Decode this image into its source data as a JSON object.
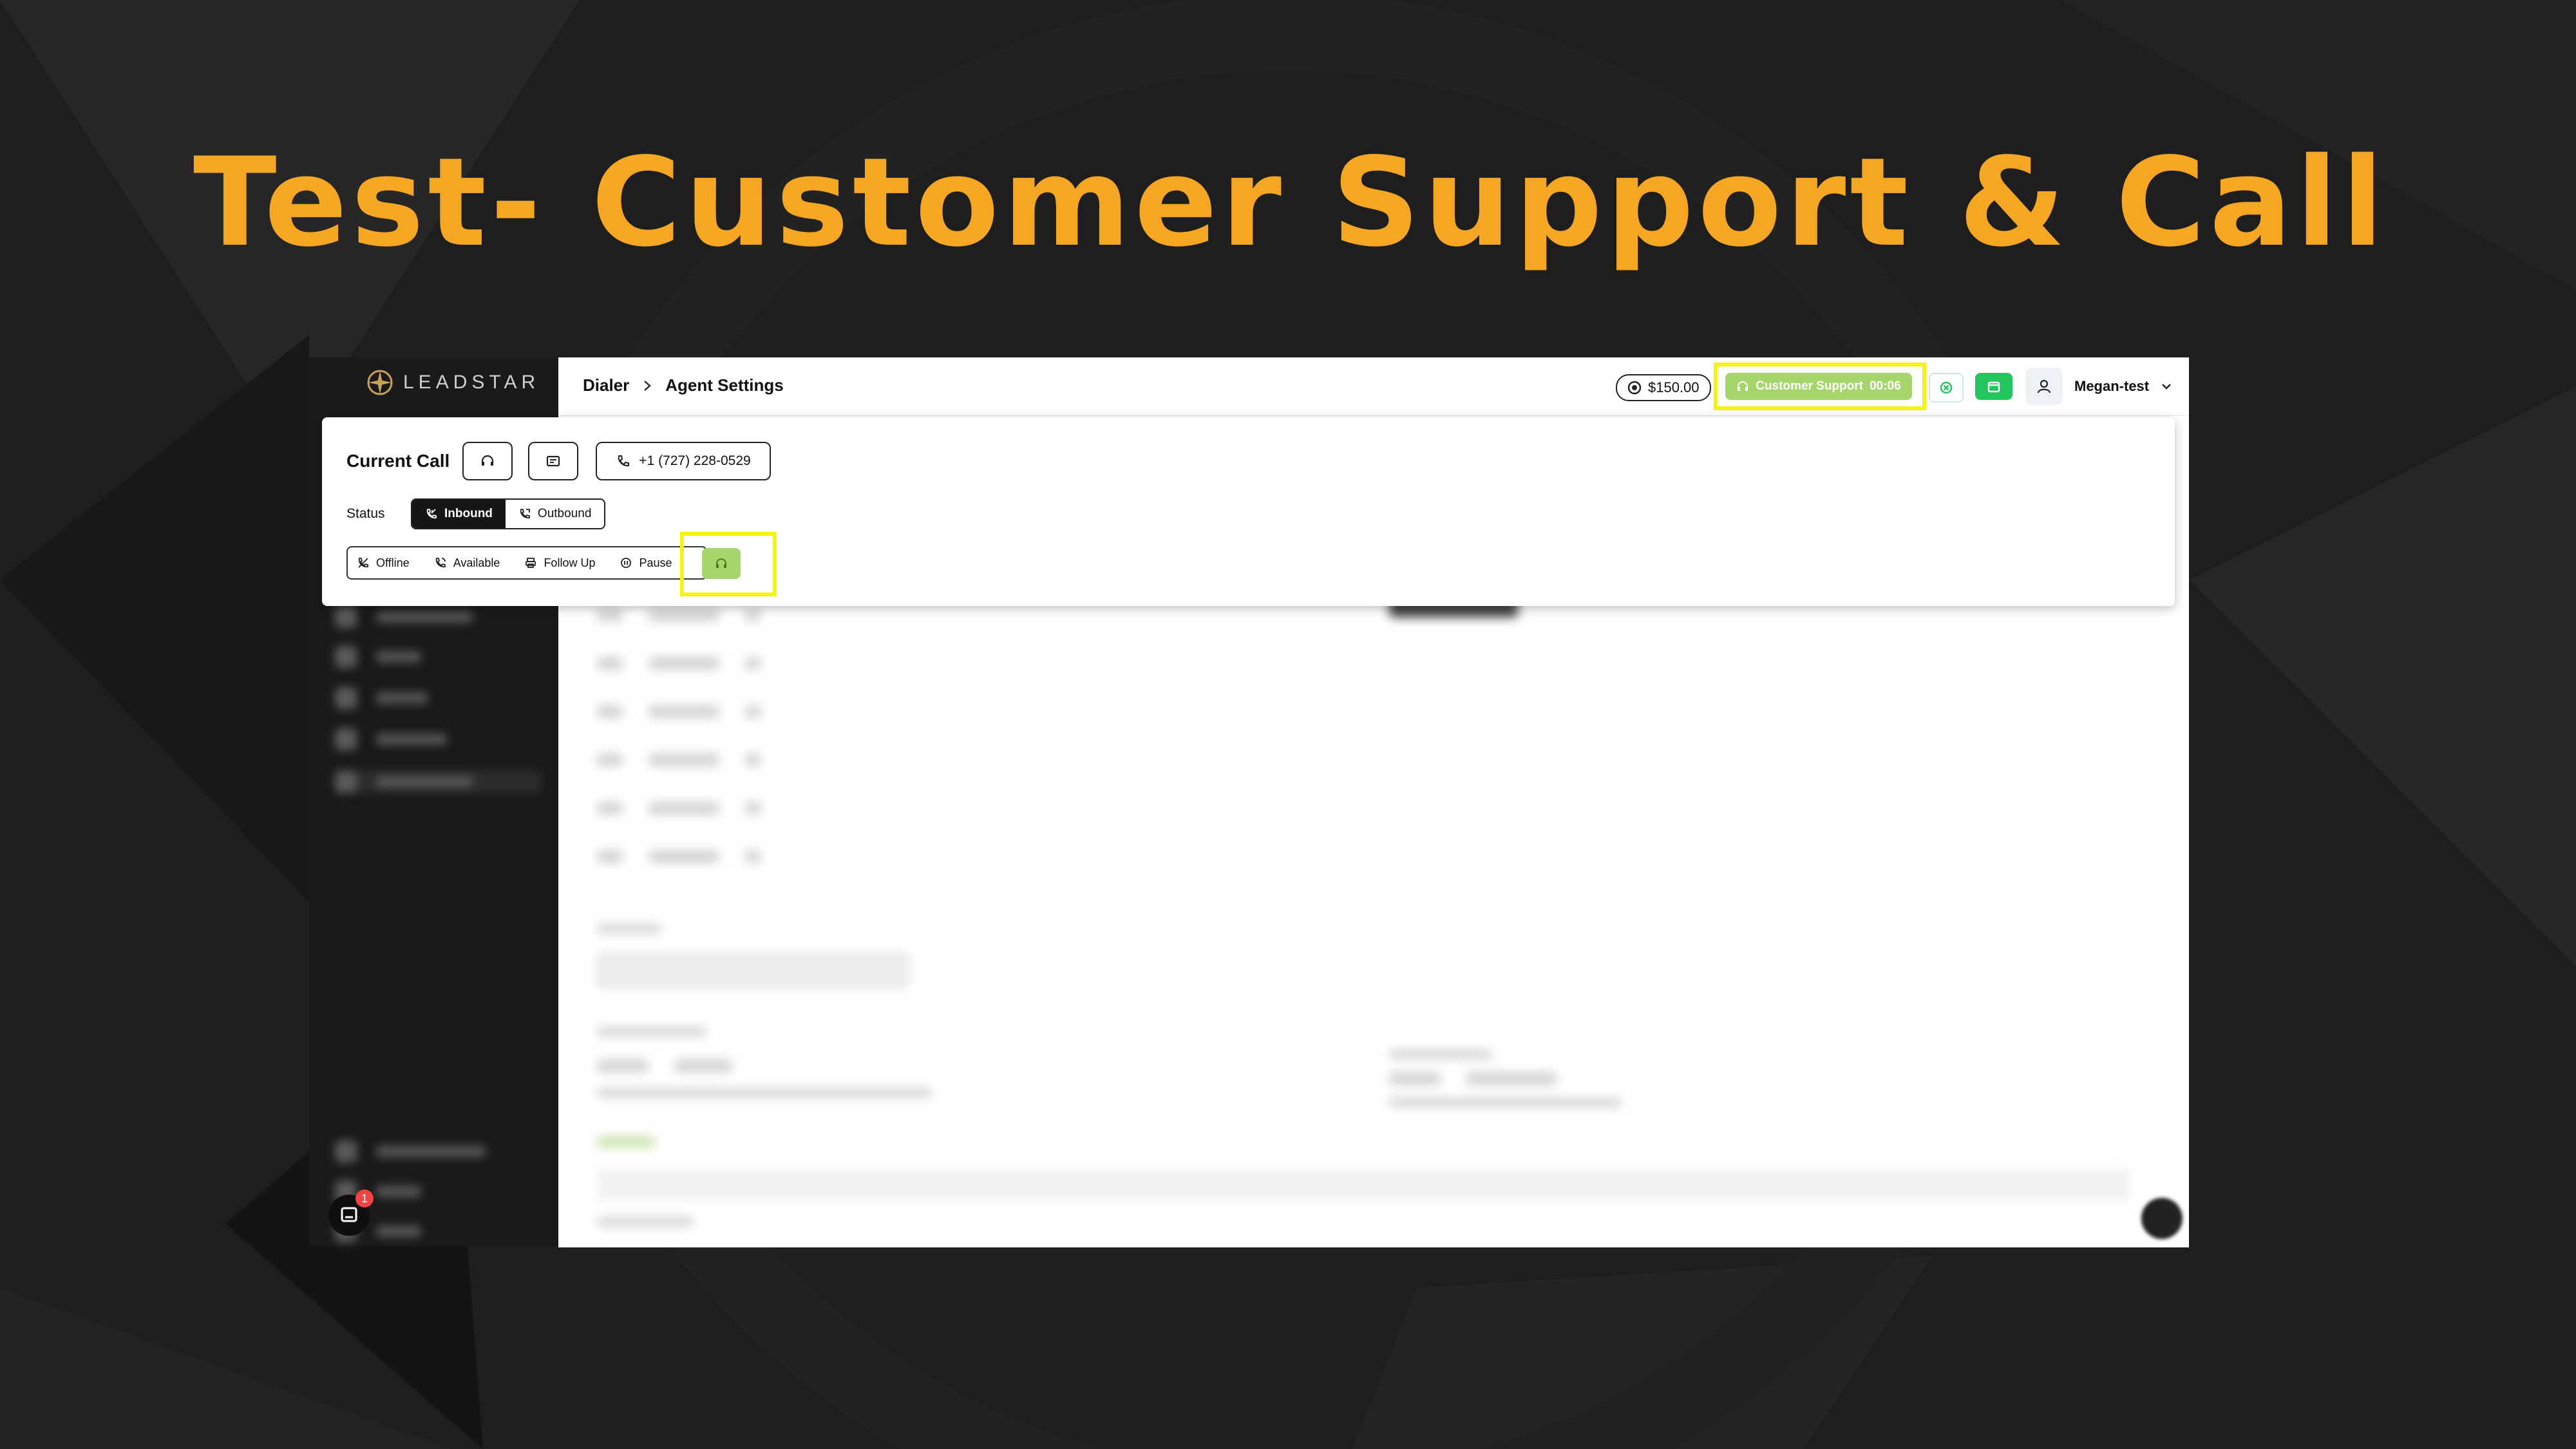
{
  "slide": {
    "title": "Test- Customer Support & Call"
  },
  "app": {
    "brand": "LEADSTAR",
    "breadcrumb": {
      "root": "Dialer",
      "current": "Agent Settings"
    },
    "balance": "$150.00",
    "active_status": {
      "label": "Customer Support",
      "timer": "00:06",
      "color": "#a6d56b"
    },
    "user": {
      "name": "Megan-test"
    },
    "chat_badge_count": "1"
  },
  "current_call": {
    "title": "Current Call",
    "phone": "+1 (727) 228-0529",
    "status_label": "Status",
    "direction_options": [
      {
        "label": "Inbound",
        "active": true
      },
      {
        "label": "Outbound",
        "active": false
      }
    ],
    "agent_states": [
      "Offline",
      "Available",
      "Follow Up",
      "Pause"
    ]
  },
  "colors": {
    "accent_title": "#f5a623",
    "highlight": "#f4f40f",
    "green": "#22c55e"
  },
  "icons": [
    "leadstar-logo-icon",
    "chevron-right-icon",
    "coin-icon",
    "headset-icon",
    "circle-x-icon",
    "calendar-icon",
    "user-icon",
    "chevron-down-icon",
    "phone-icon",
    "card-icon",
    "phone-incoming-icon",
    "phone-outgoing-icon",
    "phone-off-icon",
    "phone-call-icon",
    "printer-icon",
    "pause-circle-icon",
    "chat-icon"
  ]
}
